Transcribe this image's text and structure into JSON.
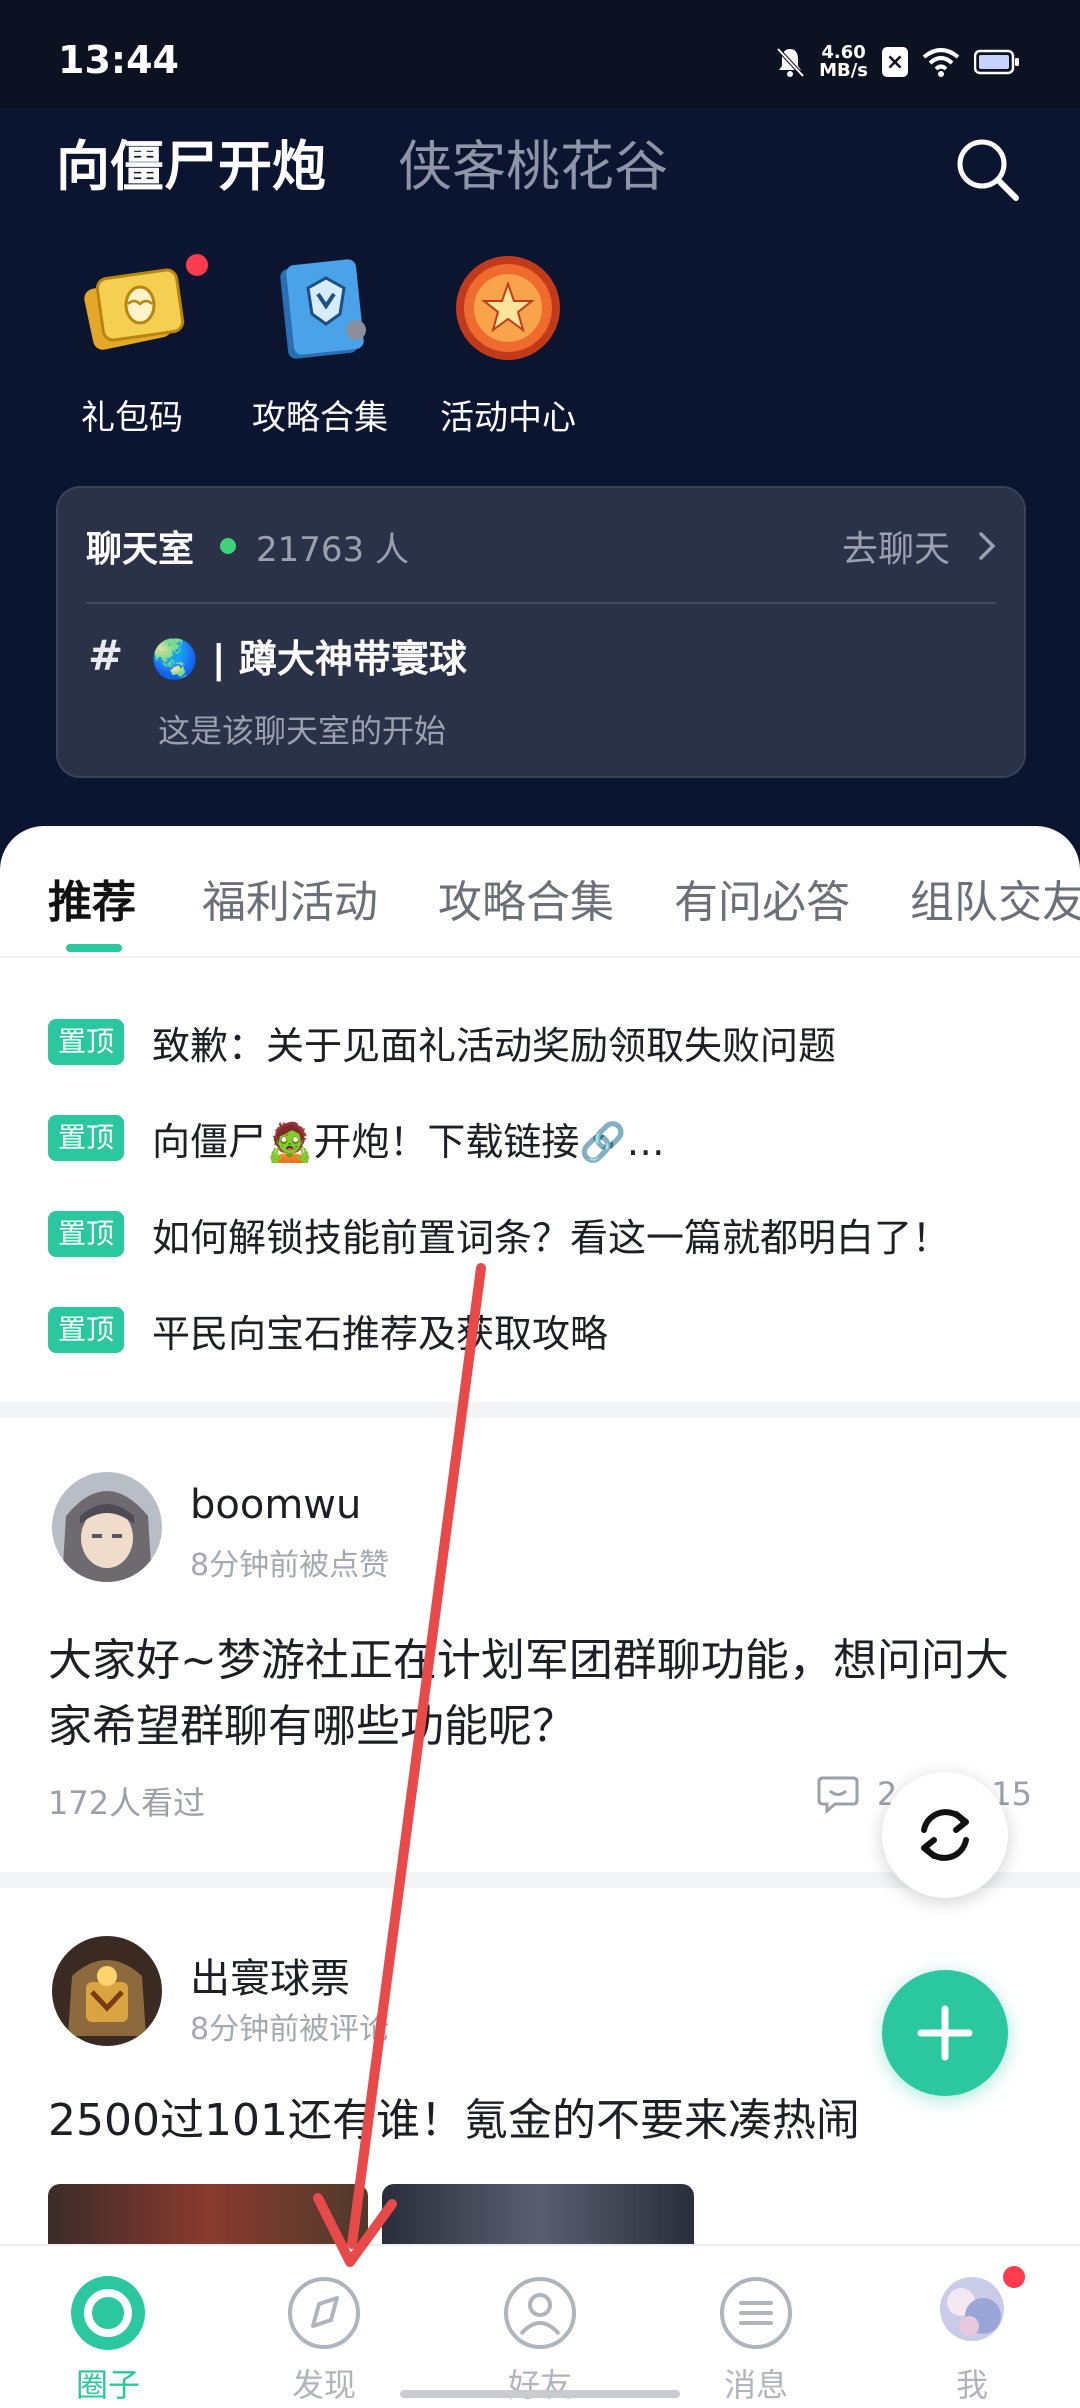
{
  "status_bar": {
    "time": "13:44",
    "net_speed_value": "4.60",
    "net_speed_unit": "MB/s",
    "icons": [
      "mute-bell-icon",
      "close-box-icon",
      "wifi-icon",
      "battery-icon"
    ]
  },
  "header": {
    "active_game": "向僵尸开炮",
    "other_game": "侠客桃花谷",
    "search_icon": "search-icon"
  },
  "shortcuts": [
    {
      "label": "礼包码",
      "icon": "gift-ticket-icon",
      "has_dot": true
    },
    {
      "label": "攻略合集",
      "icon": "guide-book-icon",
      "has_dot": false
    },
    {
      "label": "活动中心",
      "icon": "star-badge-icon",
      "has_dot": false
    }
  ],
  "chat_room": {
    "title": "聊天室",
    "online_count": "21763 人",
    "go_chat": "去聊天",
    "channel_hash": "#",
    "channel_emoji": "🌏",
    "channel_name": "| 蹲大神带寰球",
    "channel_sub": "这是该聊天室的开始"
  },
  "category_tabs": [
    "推荐",
    "福利活动",
    "攻略合集",
    "有问必答",
    "组队交友"
  ],
  "pinned": {
    "badge": "置顶",
    "items": [
      "致歉：关于见面礼活动奖励领取失败问题",
      "向僵尸🧟开炮！下载链接🔗…",
      "如何解锁技能前置词条？看这一篇就都明白了！",
      "平民向宝石推荐及获取攻略"
    ]
  },
  "posts": [
    {
      "user": "boomwu",
      "meta": "8分钟前被点赞",
      "text": "大家好~梦游社正在计划军团群聊功能，想问问大家希望群聊有哪些功能呢？",
      "views": "172人看过",
      "comments": "2",
      "likes": "15"
    },
    {
      "user": "出寰球票",
      "meta": "8分钟前被评论",
      "text": "2500过101还有谁！氪金的不要来凑热闹"
    }
  ],
  "bottom_nav": [
    {
      "label": "圈子",
      "icon": "circle-icon",
      "active": true
    },
    {
      "label": "发现",
      "icon": "compass-icon",
      "active": false
    },
    {
      "label": "好友",
      "icon": "friend-icon",
      "active": false
    },
    {
      "label": "消息",
      "icon": "message-icon",
      "active": false
    },
    {
      "label": "我",
      "icon": "avatar-icon",
      "active": false
    }
  ],
  "colors": {
    "accent": "#2bc8a0",
    "dark_bg": "#0b1530",
    "card_bg": "#2b3247",
    "overlay_arrow": "#e84a4a"
  }
}
